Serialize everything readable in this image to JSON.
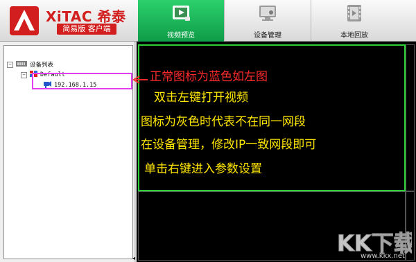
{
  "brand": {
    "logo_text": "XiTAC 希泰",
    "edition_badge": "简易版 客户端"
  },
  "tabs": [
    {
      "label": "视频预览",
      "icon": "video-preview-icon",
      "active": true
    },
    {
      "label": "设备管理",
      "icon": "device-management-icon",
      "active": false
    },
    {
      "label": "本地回放",
      "icon": "local-playback-icon",
      "active": false
    }
  ],
  "tree": {
    "root_label": "设备列表",
    "group_label": "Default",
    "device_label": "192.168.1.15",
    "root_expander": "−",
    "group_expander": "−"
  },
  "annotation": {
    "lines": [
      "正常图标为蓝色如左图",
      "双击左键打开视频",
      "图标为灰色时代表不在同一网段",
      "在设备管理，修改IP一致网段即可",
      "单击右键进入参数设置"
    ]
  },
  "colors": {
    "active_tab": "#18b456",
    "brand_red": "#d21e1e",
    "selected_cell_border": "#2fcf3a",
    "highlight_box": "#e23ef0",
    "annotation_red": "#ff2a2a",
    "annotation_yellow": "#ffe600"
  },
  "watermark": {
    "logo_text": "KK下载",
    "site": "www.kkx.net"
  },
  "collapse_toggle": "◂"
}
